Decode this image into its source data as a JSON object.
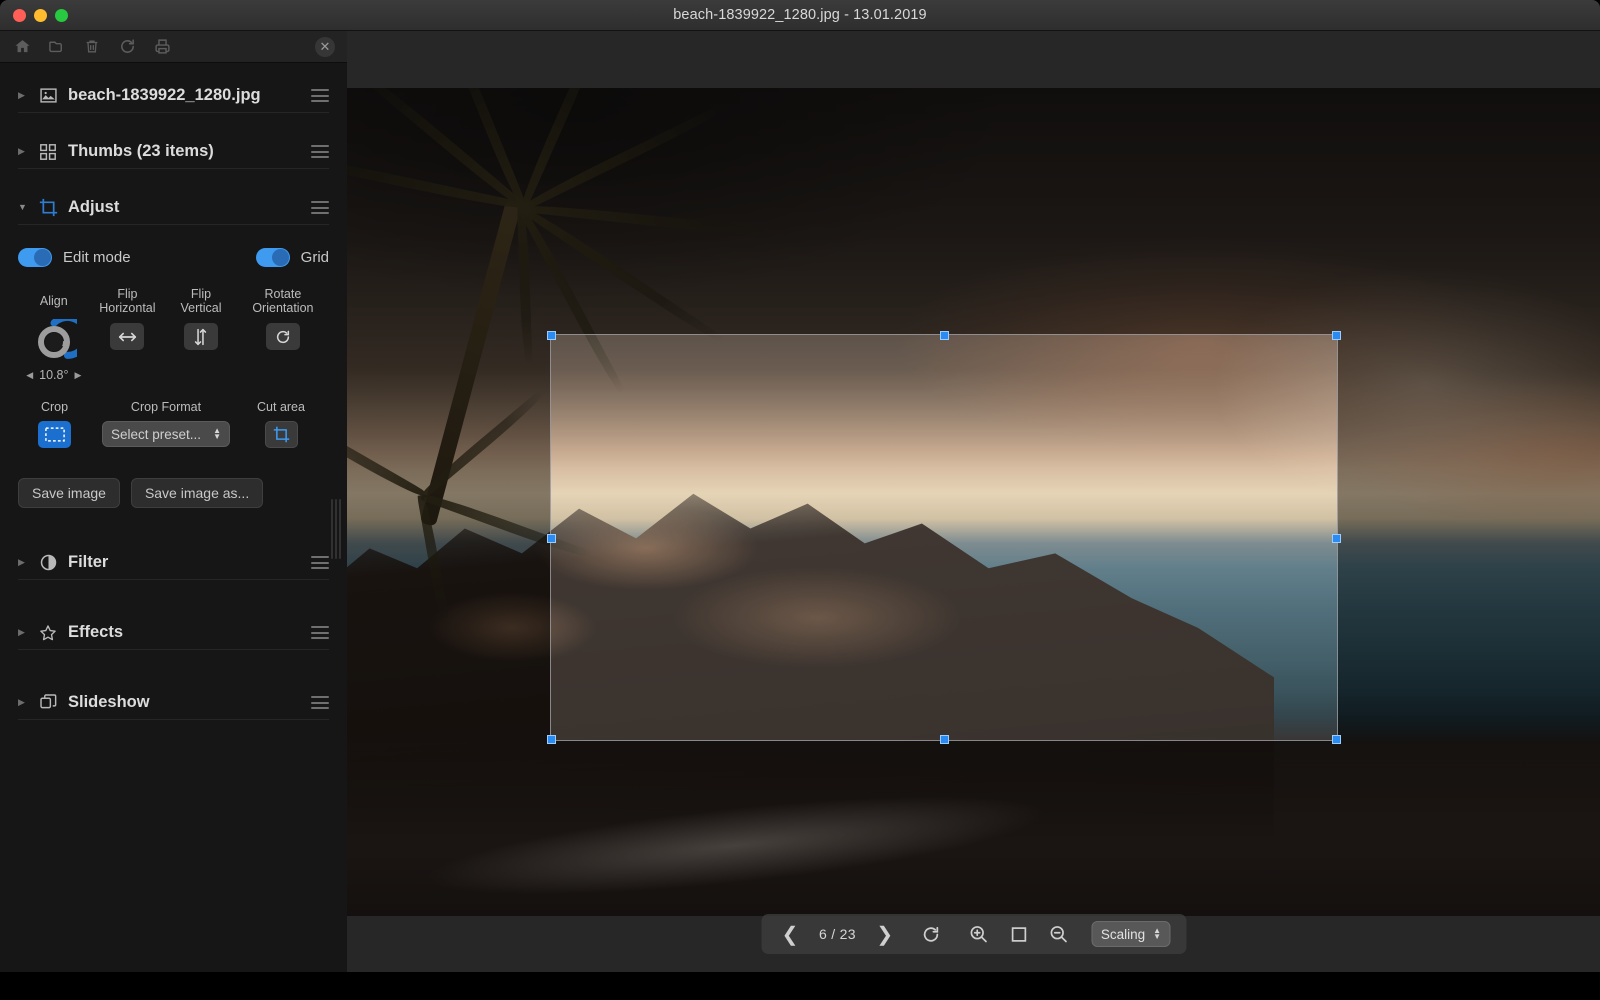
{
  "window": {
    "title": "beach-1839922_1280.jpg - 13.01.2019",
    "traffic_lights": [
      "close",
      "minimize",
      "zoom"
    ]
  },
  "toolbar": {
    "items": [
      {
        "name": "home-icon",
        "label": "Home"
      },
      {
        "name": "open-folder-icon",
        "label": "Open"
      },
      {
        "name": "trash-icon",
        "label": "Delete"
      },
      {
        "name": "reload-icon",
        "label": "Reload"
      },
      {
        "name": "print-icon",
        "label": "Print"
      }
    ],
    "close_label": "✕"
  },
  "sidebar": {
    "file_section": {
      "label": "beach-1839922_1280.jpg",
      "icon": "image-icon",
      "expanded": false
    },
    "thumbs_section": {
      "label": "Thumbs (23 items)",
      "icon": "grid-icon",
      "expanded": false
    },
    "adjust_section": {
      "label": "Adjust",
      "icon": "crop-icon",
      "expanded": true,
      "toggles": [
        {
          "label": "Edit mode",
          "on": true
        },
        {
          "label": "Grid",
          "on": true
        }
      ],
      "align": {
        "label": "Align",
        "value": "10.8°",
        "dec_arrow": "◀",
        "inc_arrow": "▶"
      },
      "flip_horizontal": {
        "label_line1": "Flip",
        "label_line2": "Horizontal"
      },
      "flip_vertical": {
        "label_line1": "Flip",
        "label_line2": "Vertical"
      },
      "rotate_orientation": {
        "label_line1": "Rotate",
        "label_line2": "Orientation"
      },
      "crop": {
        "label": "Crop",
        "active": true
      },
      "crop_format": {
        "label": "Crop Format",
        "value": "Select preset..."
      },
      "cut_area": {
        "label": "Cut area"
      },
      "save_image": "Save image",
      "save_image_as": "Save image as..."
    },
    "filter_section": {
      "label": "Filter",
      "icon": "contrast-icon",
      "expanded": false
    },
    "effects_section": {
      "label": "Effects",
      "icon": "star-icon",
      "expanded": false
    },
    "slideshow_section": {
      "label": "Slideshow",
      "icon": "layers-icon",
      "expanded": false
    }
  },
  "viewport": {
    "image_alt": "Sunset beach with palm tree, rocky coastline and ocean",
    "bottom_bar": {
      "prev_label": "❮",
      "counter": "6 / 23",
      "next_label": "❯",
      "rotate_label": "Rotate",
      "zoom_in_label": "Zoom in",
      "fit_label": "Actual size",
      "zoom_out_label": "Zoom out",
      "scaling_value": "Scaling"
    }
  },
  "colors": {
    "accent_blue": "#3e9bf0",
    "handle_blue": "#2a8bf2",
    "sidebar_bg": "#161616",
    "viewport_bg": "#272727",
    "title_bg": "#343434"
  }
}
